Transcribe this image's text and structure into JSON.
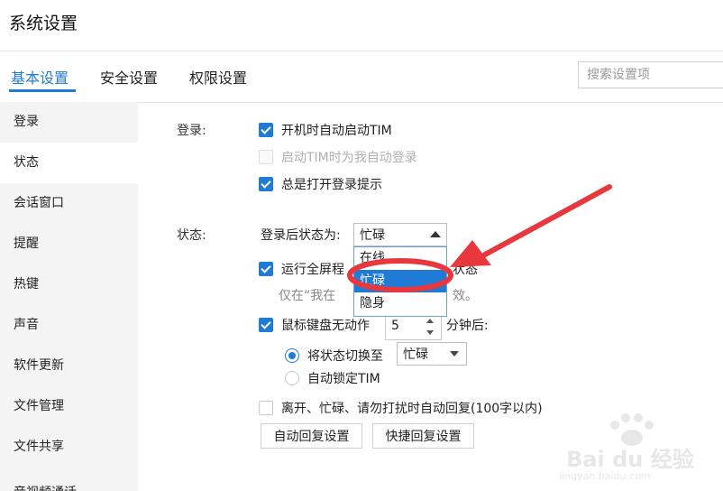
{
  "window": {
    "title": "系统设置"
  },
  "tabs": [
    {
      "label": "基本设置",
      "active": true
    },
    {
      "label": "安全设置"
    },
    {
      "label": "权限设置"
    }
  ],
  "search": {
    "placeholder": "搜索设置项"
  },
  "sidebar": {
    "items": [
      {
        "label": "登录"
      },
      {
        "label": "状态",
        "active": true
      },
      {
        "label": "会话窗口"
      },
      {
        "label": "提醒"
      },
      {
        "label": "热键"
      },
      {
        "label": "声音"
      },
      {
        "label": "软件更新"
      },
      {
        "label": "文件管理"
      },
      {
        "label": "文件共享"
      },
      {
        "label": "音视频通话"
      }
    ]
  },
  "login": {
    "label": "登录:",
    "auto_start": {
      "label": "开机时自动启动TIM",
      "checked": true
    },
    "auto_login": {
      "label": "启动TIM时为我自动登录",
      "checked": false,
      "disabled": true
    },
    "show_tip": {
      "label": "总是打开登录提示",
      "checked": true
    }
  },
  "status": {
    "label": "状态:",
    "after_login_label": "登录后状态为:",
    "after_login_value": "忙碌",
    "dropdown_options": [
      "在线",
      "忙碌",
      "隐身"
    ],
    "dropdown_selected": 1,
    "fullscreen": {
      "label_start": "运行全屏程",
      "label_end": "状态",
      "checked": true
    },
    "fullscreen_hint": {
      "start": "仅在“我在",
      "end": "效。"
    },
    "idle": {
      "label": "鼠标键盘无动作",
      "minutes": "5",
      "suffix": "分钟后:",
      "checked": true
    },
    "switch_to": {
      "label": "将状态切换至",
      "value": "忙碌",
      "selected": true
    },
    "auto_lock": {
      "label": "自动锁定TIM",
      "selected": false
    },
    "auto_reply": {
      "label": "离开、忙碌、请勿打扰时自动回复(100字以内)",
      "checked": false
    },
    "auto_reply_button": "自动回复设置",
    "quick_reply_button": "快捷回复设置"
  },
  "colors": {
    "accent": "#1f7bd6",
    "annotation": "#e8383d"
  },
  "watermark": {
    "brand": "Bai du 经验",
    "url": "jingyan.baidu.com"
  }
}
